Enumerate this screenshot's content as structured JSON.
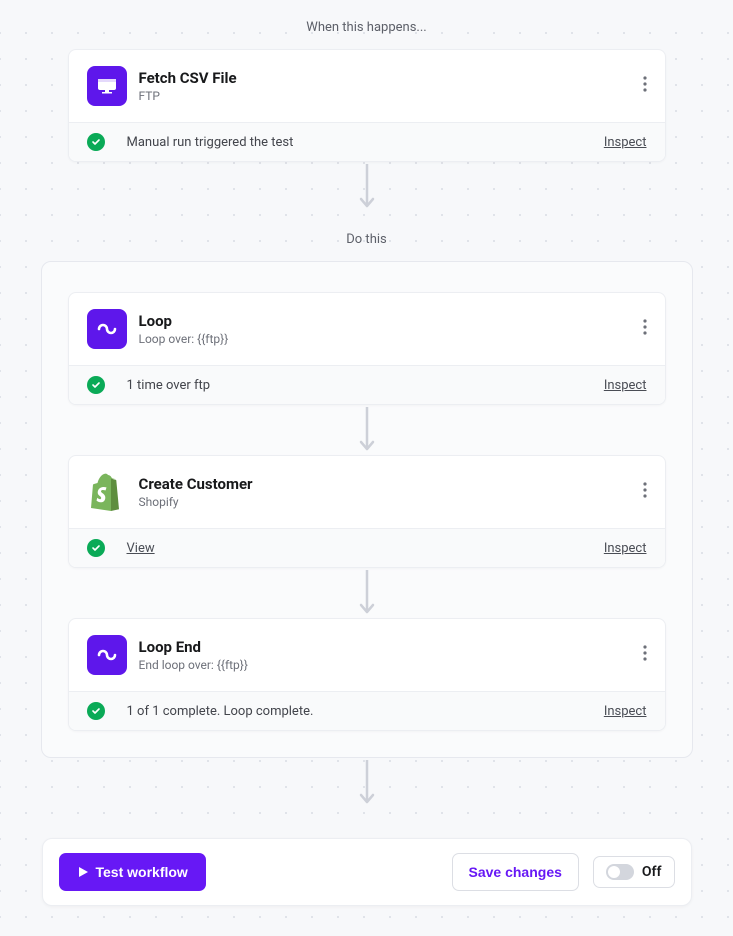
{
  "trigger_section_label": "When this happens...",
  "action_section_label": "Do this",
  "trigger": {
    "title": "Fetch CSV File",
    "subtitle": "FTP",
    "status": "Manual run triggered the test",
    "inspect": "Inspect"
  },
  "loop_start": {
    "title": "Loop",
    "subtitle": "Loop over: {{ftp}}",
    "status": "1 time over ftp",
    "inspect": "Inspect"
  },
  "create_customer": {
    "title": "Create Customer",
    "subtitle": "Shopify",
    "view": "View",
    "inspect": "Inspect"
  },
  "loop_end": {
    "title": "Loop End",
    "subtitle": "End loop over: {{ftp}}",
    "status": "1 of 1 complete. Loop complete.",
    "inspect": "Inspect"
  },
  "footer": {
    "test_btn": "Test workflow",
    "save_btn": "Save changes",
    "toggle_label": "Off"
  }
}
